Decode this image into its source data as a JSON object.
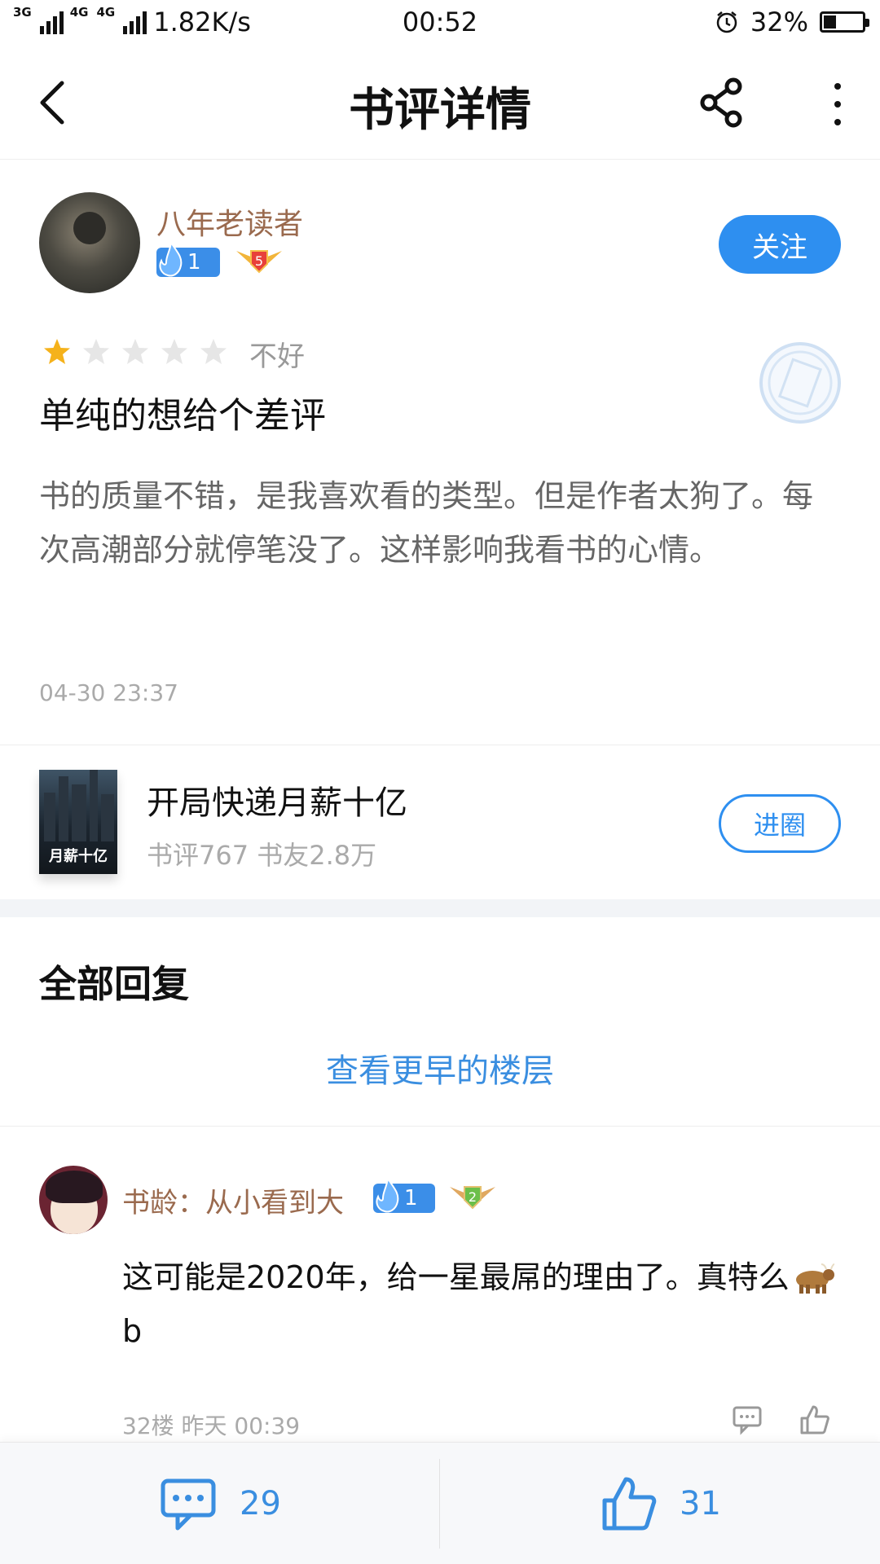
{
  "status_bar": {
    "network_label_1": "3G",
    "network_label_2": "4G",
    "network_label_3": "4G",
    "speed": "1.82K/s",
    "time": "00:52",
    "battery_percent_text": "32%",
    "battery_level": 0.32
  },
  "nav": {
    "title": "书评详情",
    "icons": [
      "back-icon",
      "share-icon",
      "more-icon"
    ]
  },
  "review": {
    "author": "八年老读者",
    "author_level": "1",
    "author_rank": "5",
    "follow_label": "关注",
    "rating": 1,
    "rating_max": 5,
    "rating_word": "不好",
    "title": "单纯的想给个差评",
    "body": "书的质量不错，是我喜欢看的类型。但是作者太狗了。每次高潮部分就停笔没了。这样影响我看书的心情。",
    "time": "04-30 23:37"
  },
  "book": {
    "name": "开局快递月薪十亿",
    "meta": "书评767 书友2.8万",
    "cover_title": "月薪十亿",
    "enter_label": "进圈"
  },
  "replies": {
    "section_title": "全部回复",
    "earlier_link": "查看更早的楼层",
    "items": [
      {
        "user": "书龄：从小看到大",
        "level": "1",
        "rank": "2",
        "text_before": "这可能是2020年，给一星最屌的理由了。真特么",
        "text_after": "b",
        "meta": "32楼 昨天 00:39"
      }
    ]
  },
  "bottom_bar": {
    "comment_count": "29",
    "like_count": "31"
  },
  "colors": {
    "accent_blue": "#2e8ff0",
    "username_brown": "#9a6a4e",
    "star_gold": "#f5b21b"
  }
}
